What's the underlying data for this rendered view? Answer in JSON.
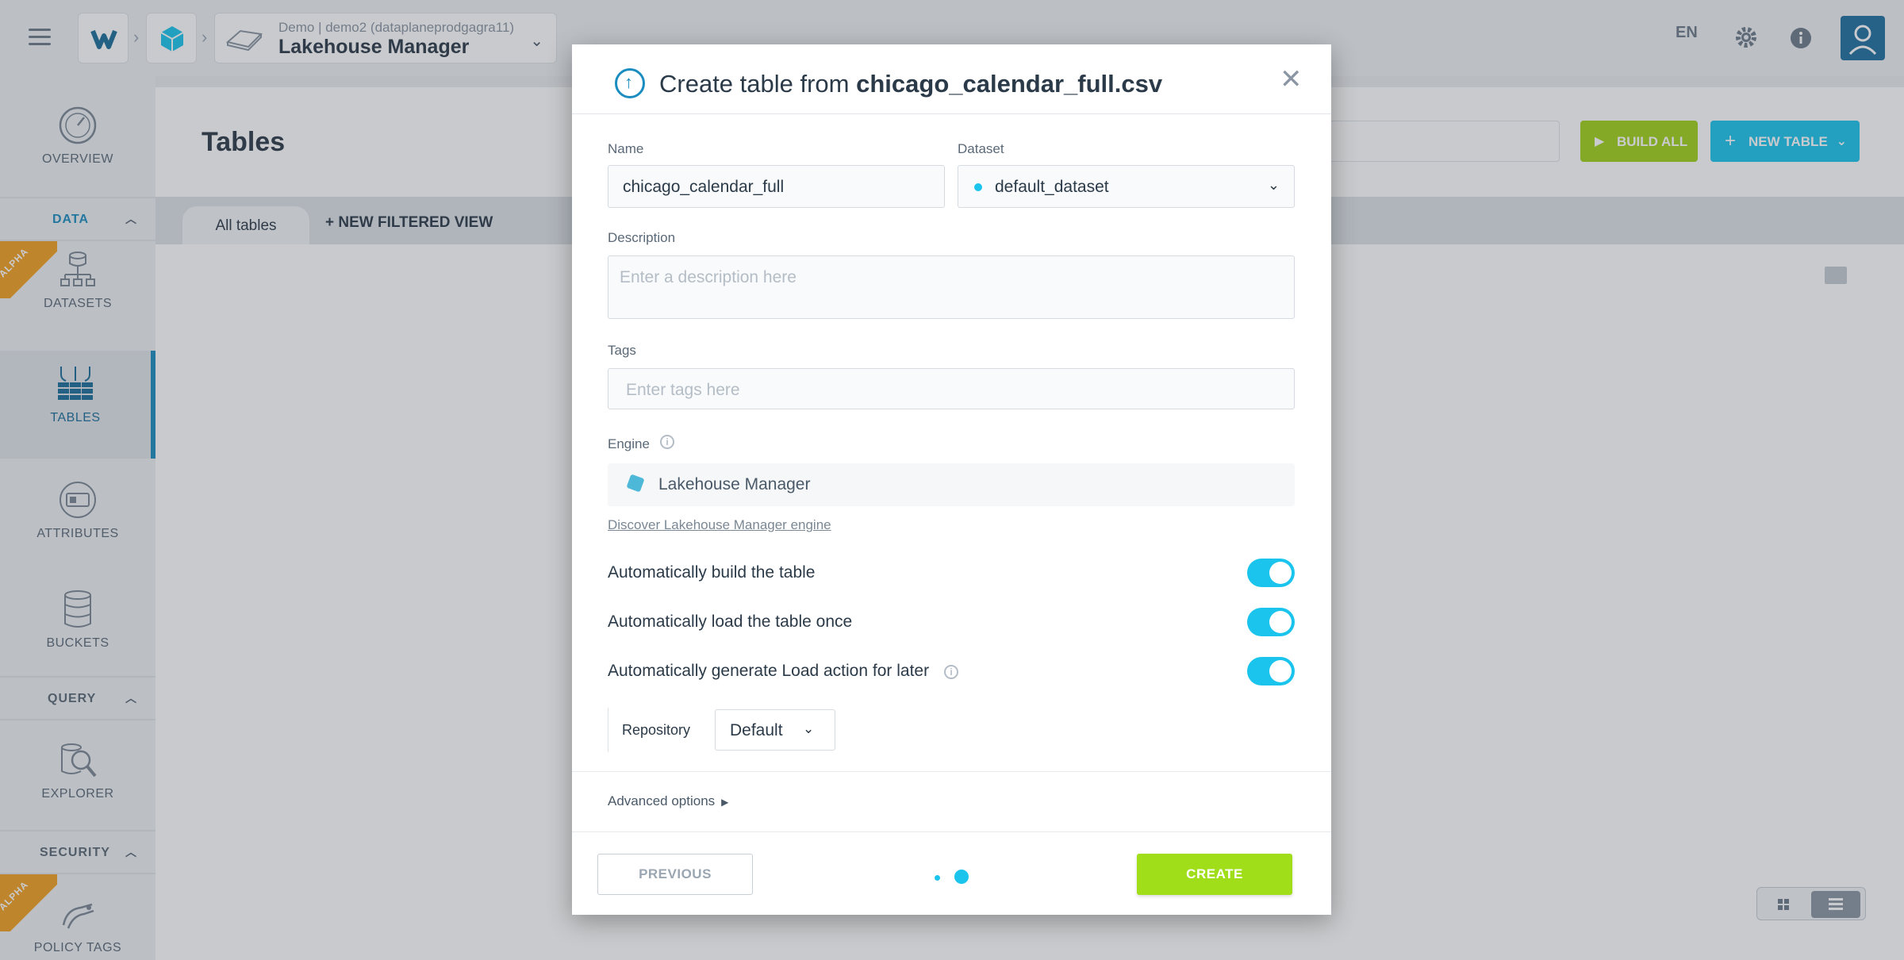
{
  "topbar": {
    "project_small": "Demo | demo2 (dataplaneprodgagra11)",
    "project_title": "Lakehouse Manager",
    "language": "EN"
  },
  "sidebar": {
    "items": [
      {
        "label": "OVERVIEW"
      },
      {
        "label": "DATASETS"
      },
      {
        "label": "TABLES"
      },
      {
        "label": "ATTRIBUTES"
      },
      {
        "label": "BUCKETS"
      },
      {
        "label": "EXPLORER"
      },
      {
        "label": "POLICY TAGS"
      }
    ],
    "sections": {
      "data": "DATA",
      "query": "QUERY",
      "security": "SECURITY"
    },
    "alpha_badge": "ALPHA"
  },
  "main": {
    "title": "Tables",
    "build_all": "BUILD ALL",
    "new_table": "NEW TABLE",
    "tabs": {
      "all": "All tables",
      "new_view": "NEW FILTERED VIEW"
    }
  },
  "modal": {
    "title_prefix": "Create table from ",
    "title_file": "chicago_calendar_full.csv",
    "name_label": "Name",
    "name_value": "chicago_calendar_full",
    "dataset_label": "Dataset",
    "dataset_value": "default_dataset",
    "description_label": "Description",
    "description_placeholder": "Enter a description here",
    "tags_label": "Tags",
    "tags_placeholder": "Enter tags here",
    "engine_label": "Engine",
    "engine_value": "Lakehouse Manager",
    "discover_link": "Discover Lakehouse Manager engine",
    "toggles": [
      {
        "label": "Automatically build the table",
        "on": true
      },
      {
        "label": "Automatically load the table once",
        "on": true
      },
      {
        "label": "Automatically generate Load action for later",
        "on": true
      }
    ],
    "repository_label": "Repository",
    "repository_value": "Default",
    "advanced_options": "Advanced options",
    "previous": "PREVIOUS",
    "create": "CREATE"
  },
  "colors": {
    "accent": "#1ac4ec",
    "create_green": "#9fde18",
    "build_green": "#9fd21a",
    "sidebar_active": "#1a8cc0"
  }
}
